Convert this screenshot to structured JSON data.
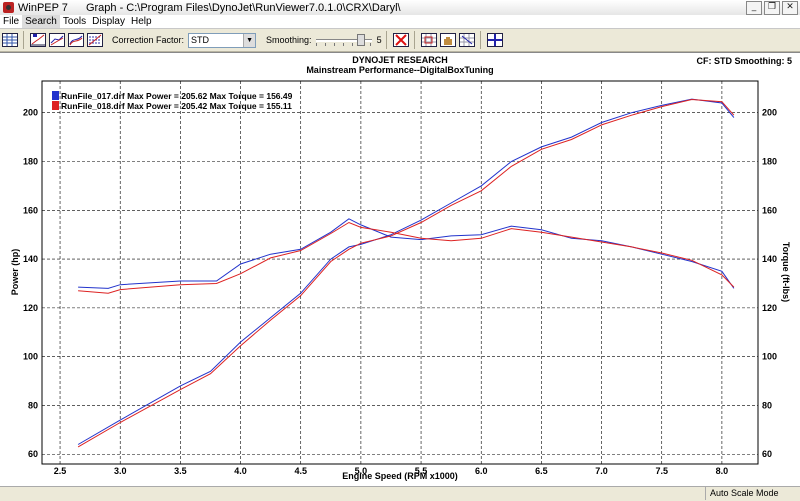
{
  "window": {
    "app_name": "WinPEP 7",
    "title": "Graph - C:\\Program Files\\DynoJet\\RunViewer7.0.1.0\\CRX\\Daryl\\",
    "minimize_glyph": "_",
    "restore_glyph": "❐",
    "close_glyph": "✕"
  },
  "menu": {
    "items": [
      "File",
      "Search",
      "Tools",
      "Display",
      "Help"
    ],
    "active_index": 1
  },
  "toolbar": {
    "correction_factor_label": "Correction Factor:",
    "correction_factor_value": "STD",
    "smoothing_label": "Smoothing:",
    "smoothing_value": "5",
    "smoothing_level_fraction": 0.83,
    "icons": [
      "tile-windows-icon",
      "graph-power-icon",
      "graph-torque-icon",
      "graph-overlay-icon",
      "graph-multi-icon",
      "delete-run-icon",
      "zoom-in-icon",
      "pan-hand-icon",
      "zoom-out-icon",
      "crosshair-cursor-icon"
    ]
  },
  "graph": {
    "header_line1": "DYNOJET RESEARCH",
    "header_line2": "Mainstream Performance--DigitalBoxTuning",
    "settings_text": "CF: STD   Smoothing: 5",
    "legend": [
      {
        "text": "RunFile_017.drf Max Power = 205.62 Max Torque = 156.49",
        "color": "#2233cc"
      },
      {
        "text": "RunFile_018.drf Max Power = 205.42 Max Torque = 155.11",
        "color": "#dd2222"
      }
    ]
  },
  "chart_data": {
    "type": "line",
    "title": "DYNOJET RESEARCH",
    "subtitle": "Mainstream Performance--DigitalBoxTuning",
    "xlabel": "Engine Speed (RPM x1000)",
    "ylabel": "Power (hp)",
    "y2label": "Torque (ft-lbs)",
    "xlim": [
      2.35,
      8.3
    ],
    "ylim": [
      56,
      213
    ],
    "x_ticks": [
      "2.5",
      "3.0",
      "3.5",
      "4.0",
      "4.5",
      "5.0",
      "5.5",
      "6.0",
      "6.5",
      "7.0",
      "7.5",
      "8.0"
    ],
    "y_ticks": [
      "60",
      "80",
      "100",
      "120",
      "140",
      "160",
      "180",
      "200"
    ],
    "y2_ticks": [
      "60",
      "80",
      "100",
      "120",
      "140",
      "160",
      "180",
      "200"
    ],
    "grid": true,
    "legend_position": "top-left",
    "series": [
      {
        "name": "RunFile_017.drf",
        "color": "#2233cc",
        "power": {
          "x": [
            2.65,
            3.0,
            3.5,
            3.75,
            4.0,
            4.25,
            4.5,
            4.75,
            4.9,
            5.0,
            5.25,
            5.5,
            5.75,
            6.0,
            6.25,
            6.5,
            6.75,
            7.0,
            7.25,
            7.5,
            7.75,
            8.0,
            8.1
          ],
          "y": [
            64,
            74,
            88,
            94,
            106,
            116,
            126,
            140,
            145,
            146,
            150,
            156,
            163,
            170,
            180,
            186,
            190,
            196,
            200,
            203,
            205.6,
            204,
            198
          ]
        },
        "torque": {
          "x": [
            2.65,
            2.9,
            3.0,
            3.5,
            3.8,
            4.0,
            4.25,
            4.5,
            4.75,
            4.9,
            5.0,
            5.25,
            5.5,
            5.75,
            6.0,
            6.25,
            6.5,
            6.75,
            7.0,
            7.25,
            7.5,
            7.75,
            8.0,
            8.1
          ],
          "y": [
            128.5,
            128,
            129.5,
            131,
            131,
            138,
            142,
            144,
            151,
            156.5,
            154,
            149,
            148,
            149.5,
            150,
            153.5,
            152,
            148.5,
            147.5,
            145,
            142,
            139,
            135,
            128
          ]
        }
      },
      {
        "name": "RunFile_018.drf",
        "color": "#dd2222",
        "power": {
          "x": [
            2.65,
            3.0,
            3.5,
            3.75,
            4.0,
            4.25,
            4.5,
            4.75,
            4.9,
            5.0,
            5.25,
            5.5,
            5.75,
            6.0,
            6.25,
            6.5,
            6.75,
            7.0,
            7.25,
            7.5,
            7.75,
            8.0,
            8.1
          ],
          "y": [
            63,
            73,
            86.5,
            93,
            104.5,
            115,
            125,
            139,
            144,
            146.5,
            149.5,
            155,
            162,
            168,
            178,
            185,
            189,
            195,
            199,
            202.5,
            205.4,
            204.5,
            199
          ]
        },
        "torque": {
          "x": [
            2.65,
            2.9,
            3.0,
            3.5,
            3.8,
            4.0,
            4.25,
            4.5,
            4.75,
            4.9,
            5.0,
            5.25,
            5.5,
            5.75,
            6.0,
            6.25,
            6.5,
            6.75,
            7.0,
            7.25,
            7.5,
            7.75,
            8.0,
            8.1
          ],
          "y": [
            127,
            126,
            127.5,
            129.5,
            130,
            134,
            140.5,
            143.5,
            150.5,
            155,
            153,
            151,
            148.5,
            147.5,
            148.5,
            152.5,
            151,
            149,
            147,
            145,
            142.5,
            139.5,
            133.5,
            128.5
          ]
        }
      }
    ]
  },
  "status": {
    "mode": "Auto Scale Mode"
  }
}
